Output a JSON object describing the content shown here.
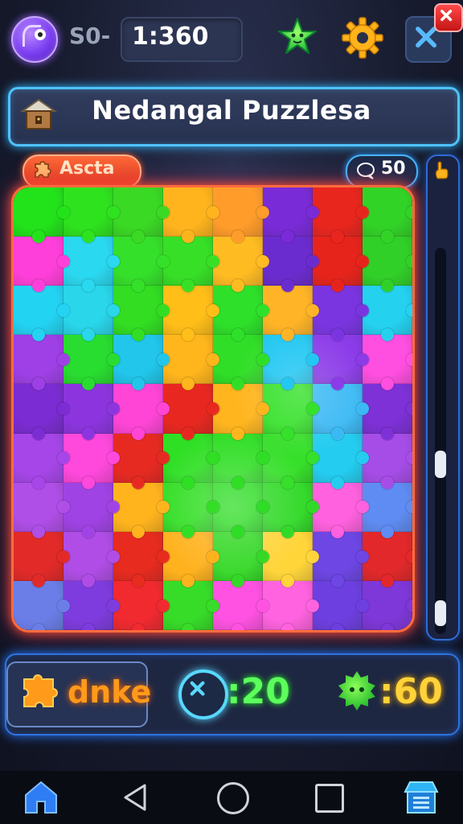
{
  "header": {
    "so_label": "S0-",
    "timer": "1:360"
  },
  "title": "Nedangal Puzzlesa",
  "badges": {
    "left_label": "Ascta",
    "hint_count": "50"
  },
  "board": {
    "rows": [
      [
        "#22e31a",
        "#2ee21e",
        "#3ad924",
        "#ffb41e",
        "#ff9c2a",
        "#7a2bd8",
        "#e9261e",
        "#32d327"
      ],
      [
        "#ff3fd9",
        "#2ad8f0",
        "#35e02a",
        "#37e026",
        "#ffbb22",
        "#6b2ccf",
        "#e7241c",
        "#31d028"
      ],
      [
        "#23d3f2",
        "#29d6ea",
        "#32dd22",
        "#ffbe18",
        "#2ee02a",
        "#ffb427",
        "#7a35e0",
        "#24d2f0"
      ],
      [
        "#9e40e6",
        "#28dd30",
        "#21c6ea",
        "#ffb51c",
        "#31de27",
        "#22c7f2",
        "#8b3be8",
        "#ff4fe0"
      ],
      [
        "#7b2cd2",
        "#8c35df",
        "#ff45d6",
        "#e82820",
        "#ffb51e",
        "#35e12a",
        "#3bb9f4",
        "#7d31d6"
      ],
      [
        "#a646e8",
        "#ff48dc",
        "#e62a22",
        "#2fdf24",
        "#30de25",
        "#36df2a",
        "#24ccef",
        "#a64de8"
      ],
      [
        "#b04ee8",
        "#a043e4",
        "#ffb41e",
        "#34de26",
        "#2fdc26",
        "#31d928",
        "#ff61df",
        "#5f8cf2"
      ],
      [
        "#e22a28",
        "#b04de6",
        "#e72b1f",
        "#ffb21e",
        "#34d826",
        "#ffd53a",
        "#6d46e4",
        "#e2282a"
      ],
      [
        "#6b7ee8",
        "#7e3cde",
        "#f12a30",
        "#37dc28",
        "#ff52e2",
        "#ff63df",
        "#6d3fe0",
        "#7e37d8"
      ]
    ]
  },
  "bottom": {
    "done_label": "dnke",
    "x_count": ":20",
    "blob_count": ":60"
  },
  "icons": {
    "avatar": "purple-creature-avatar-icon",
    "star": "green-star-icon",
    "gear": "gear-icon",
    "close": "close-icon",
    "home_mini": "house-icon",
    "ascta": "puzzle-piece-icon",
    "hint": "chat-bubble-icon",
    "rail": "hand-icon",
    "done": "puzzle-piece-icon",
    "x": "x-circle-icon",
    "blob": "green-blob-icon",
    "nav_home": "home-icon",
    "nav_back": "back-triangle-icon",
    "nav_circle": "home-circle-icon",
    "nav_square": "recents-square-icon",
    "nav_store": "store-icon"
  },
  "colors": {
    "accent_blue": "#4fc3ff",
    "board_border": "#ff6b3d",
    "done_orange": "#ff9a1a",
    "x_green": "#5cff5c",
    "blob_yellow": "#ffd23a"
  }
}
